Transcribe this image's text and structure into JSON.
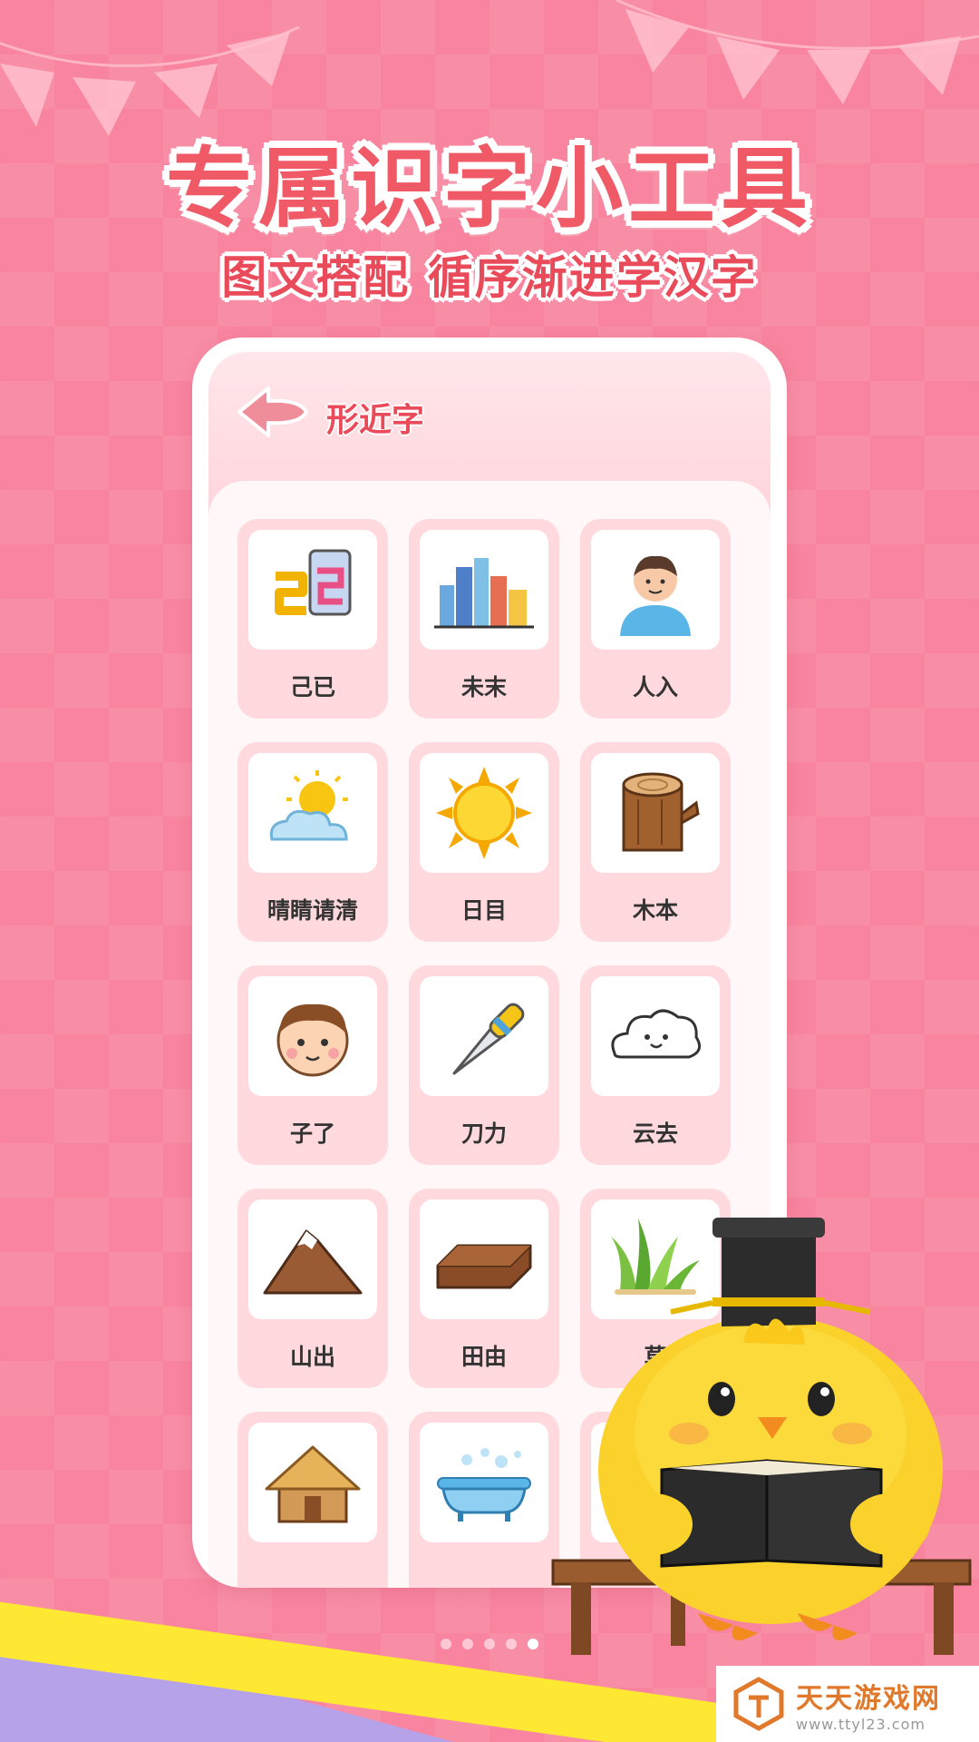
{
  "headline": "专属识字小工具",
  "subline": "图文搭配 循序渐进学汉字",
  "screen": {
    "title": "形近字",
    "cards": [
      {
        "label": "己已",
        "icon": "ji-yi-letters-icon"
      },
      {
        "label": "未末",
        "icon": "city-buildings-icon"
      },
      {
        "label": "人入",
        "icon": "person-icon"
      },
      {
        "label": "晴睛请清",
        "icon": "sun-cloud-icon"
      },
      {
        "label": "日目",
        "icon": "sun-icon"
      },
      {
        "label": "木本",
        "icon": "log-icon"
      },
      {
        "label": "子了",
        "icon": "boy-face-icon"
      },
      {
        "label": "刀力",
        "icon": "knife-icon"
      },
      {
        "label": "云去",
        "icon": "cloud-icon"
      },
      {
        "label": "山出",
        "icon": "mountain-icon"
      },
      {
        "label": "田由",
        "icon": "field-block-icon"
      },
      {
        "label": "草",
        "icon": "grass-icon"
      },
      {
        "label": "",
        "icon": "hut-icon"
      },
      {
        "label": "",
        "icon": "bathtub-icon"
      },
      {
        "label": "",
        "icon": "blank"
      }
    ]
  },
  "pagination": {
    "count": 5,
    "active": 4
  },
  "watermark": {
    "name": "天天游戏网",
    "url": "www.ttyl23.com"
  },
  "colors": {
    "background": "#f8849f",
    "accent": "#e94b5a",
    "card": "#ffd9dd"
  }
}
